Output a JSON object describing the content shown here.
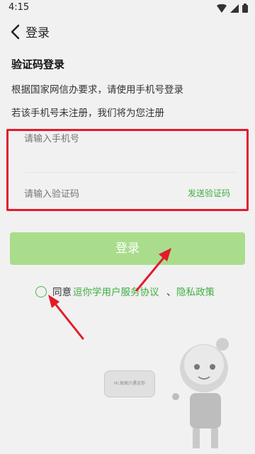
{
  "status": {
    "time": "4:15"
  },
  "header": {
    "title": "登录"
  },
  "section": {
    "title": "验证码登录"
  },
  "notes": {
    "line1": "根据国家网信办要求，请使用手机号登录",
    "line2": "若该手机号未注册，我们将为您注册"
  },
  "form": {
    "phone_placeholder": "请输入手机号",
    "code_placeholder": "请输入验证码",
    "send_code_label": "发送验证码"
  },
  "login_button": {
    "label": "登录"
  },
  "agreement": {
    "prefix": "同意",
    "terms_link": "逗你学用户服务协议",
    "separator": "、",
    "privacy_link": "隐私政策"
  },
  "mascot": {
    "bubble_text": "Hi,很高兴遇见你"
  },
  "colors": {
    "accent": "#3fae42",
    "button": "#a9dd8c",
    "highlight": "#e31b2b",
    "background": "#f1f1f1"
  },
  "icons": [
    "back-icon",
    "wifi-icon",
    "signal-icon",
    "battery-icon"
  ]
}
